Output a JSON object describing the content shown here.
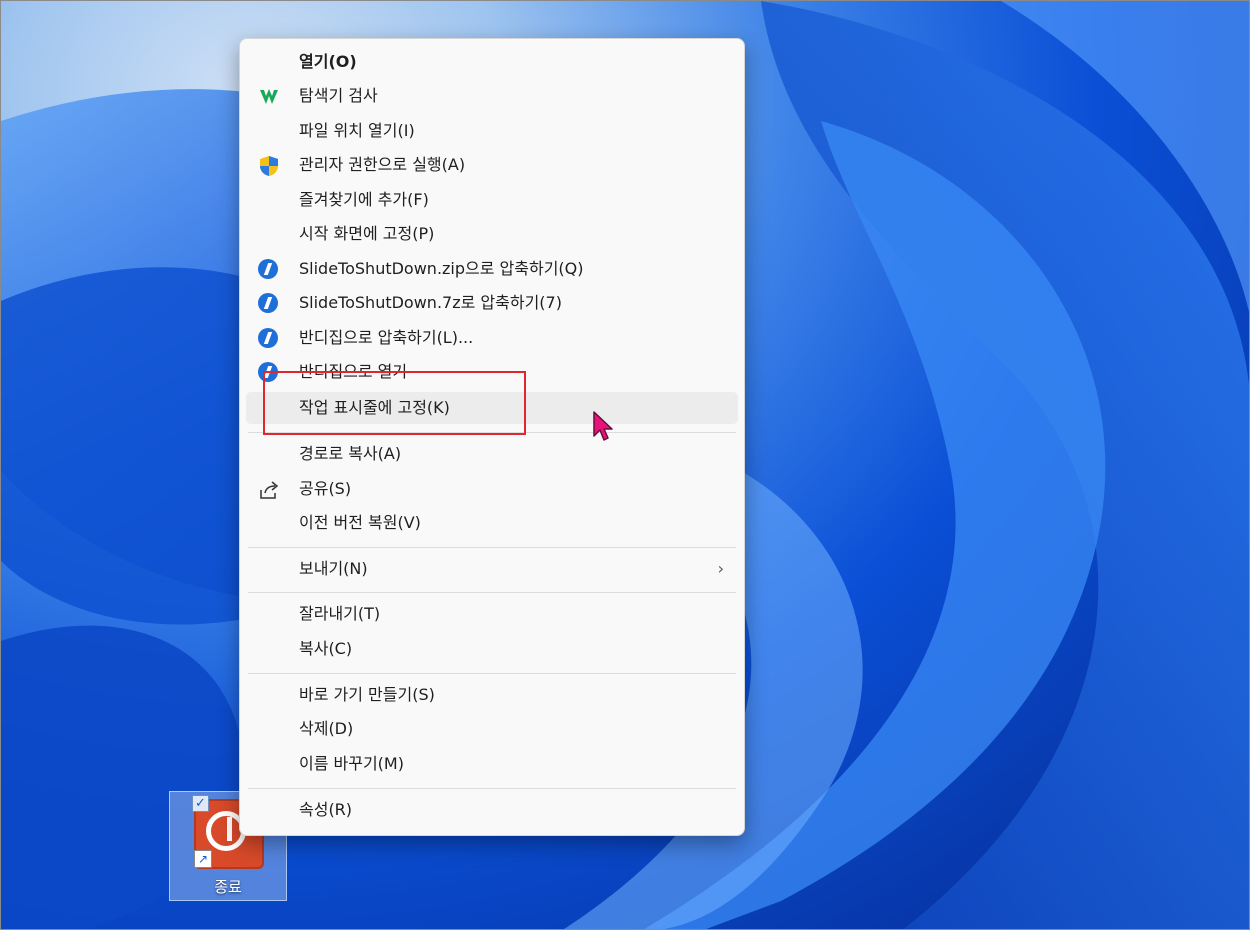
{
  "desktop": {
    "icon_label": "종료",
    "icon_name": "power-shortcut-icon",
    "tile_color": "#d84a2a"
  },
  "context_menu": {
    "groups": [
      [
        {
          "label": "열기(O)",
          "icon": null,
          "bold": true
        },
        {
          "label": "탐색기 검사",
          "icon": "explorer-scan-icon"
        },
        {
          "label": "파일 위치 열기(I)",
          "icon": null
        },
        {
          "label": "관리자 권한으로 실행(A)",
          "icon": "uac-shield-icon"
        },
        {
          "label": "즐겨찾기에 추가(F)",
          "icon": null
        },
        {
          "label": "시작 화면에 고정(P)",
          "icon": null
        },
        {
          "label": "SlideToShutDown.zip으로 압축하기(Q)",
          "icon": "bandizip-icon"
        },
        {
          "label": "SlideToShutDown.7z로 압축하기(7)",
          "icon": "bandizip-icon"
        },
        {
          "label": "반디집으로 압축하기(L)...",
          "icon": "bandizip-icon"
        },
        {
          "label": "반디집으로 열기",
          "icon": "bandizip-icon"
        },
        {
          "label": "작업 표시줄에 고정(K)",
          "icon": null,
          "highlighted": true
        }
      ],
      [
        {
          "label": "경로로 복사(A)",
          "icon": null
        },
        {
          "label": "공유(S)",
          "icon": "share-icon"
        },
        {
          "label": "이전 버전 복원(V)",
          "icon": null
        }
      ],
      [
        {
          "label": "보내기(N)",
          "icon": null,
          "submenu": true
        }
      ],
      [
        {
          "label": "잘라내기(T)",
          "icon": null
        },
        {
          "label": "복사(C)",
          "icon": null
        }
      ],
      [
        {
          "label": "바로 가기 만들기(S)",
          "icon": null
        },
        {
          "label": "삭제(D)",
          "icon": null
        },
        {
          "label": "이름 바꾸기(M)",
          "icon": null
        }
      ],
      [
        {
          "label": "속성(R)",
          "icon": null
        }
      ]
    ],
    "hover_color": "#ececec",
    "highlight_box_color": "#e0262e"
  },
  "cursor": {
    "color": "#e8127a"
  }
}
